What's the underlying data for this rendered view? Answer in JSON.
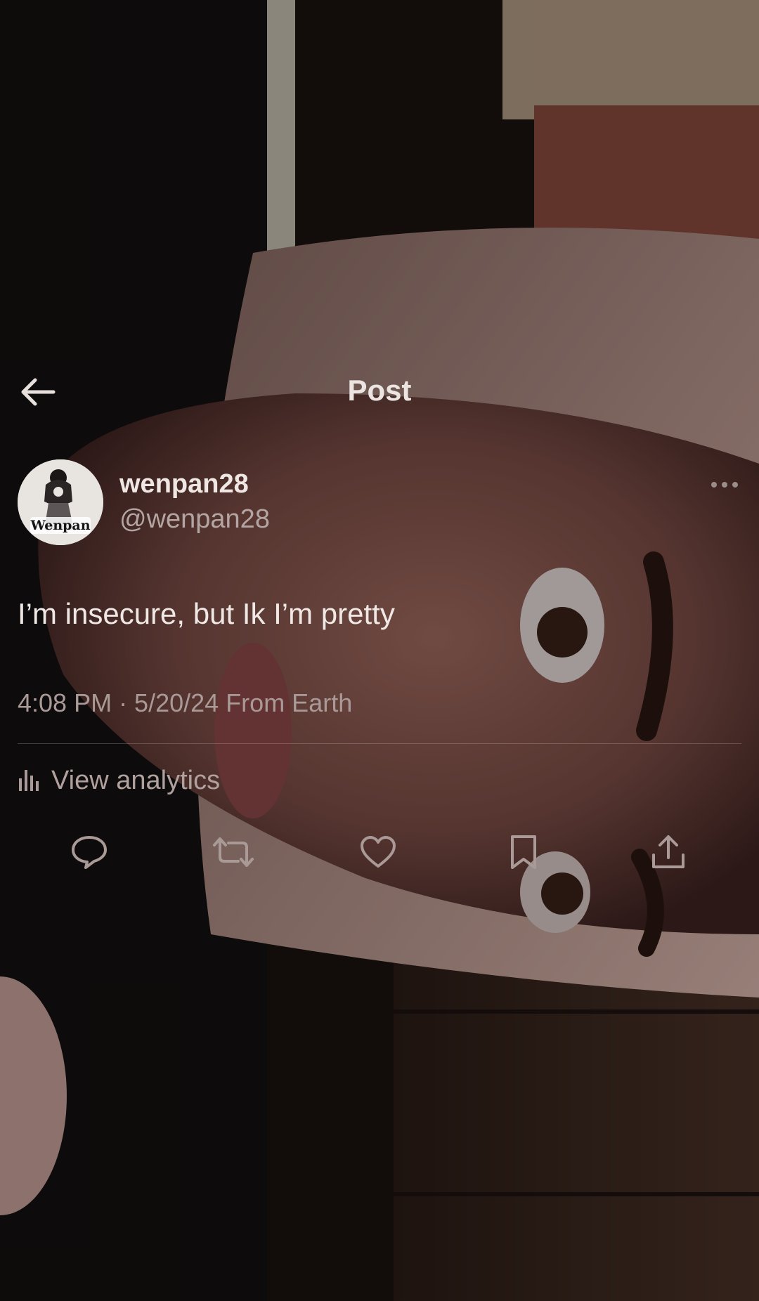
{
  "header": {
    "back_icon": "arrow-left-icon",
    "title": "Post"
  },
  "author": {
    "display_name": "wenpan28",
    "handle": "@wenpan28",
    "avatar_text": "Wenpan",
    "more_icon": "more-horizontal-icon"
  },
  "post": {
    "text": "I’m insecure, but Ik I’m pretty",
    "timestamp": "4:08 PM · 5/20/24",
    "location": "From Earth"
  },
  "analytics": {
    "icon": "bar-chart-icon",
    "label": "View analytics"
  },
  "actions": [
    {
      "icon": "reply-icon"
    },
    {
      "icon": "repost-icon"
    },
    {
      "icon": "like-icon"
    },
    {
      "icon": "bookmark-icon"
    },
    {
      "icon": "share-icon"
    }
  ],
  "colors": {
    "background": "#120d0c",
    "text_primary": "#f0e8e5",
    "text_secondary": "#a99a97",
    "skin_tone": "#8f5e55",
    "hair": "#c9a39a"
  }
}
